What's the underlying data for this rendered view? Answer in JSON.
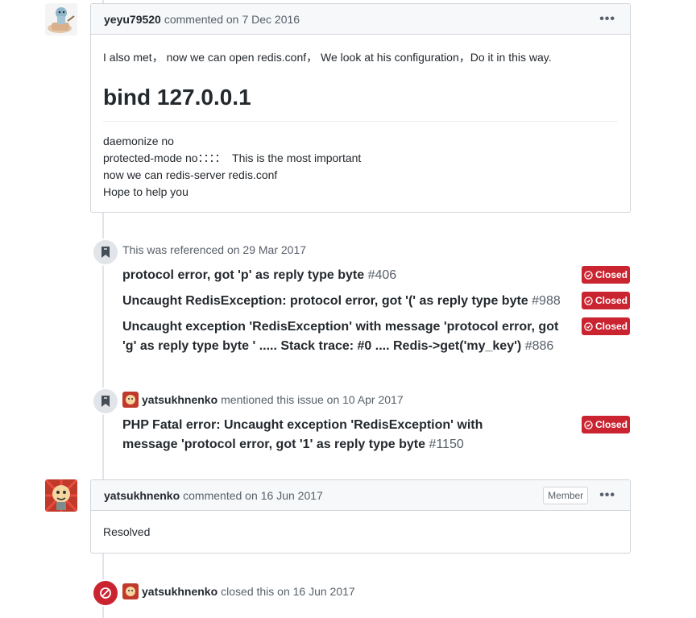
{
  "comment1": {
    "author": "yeyu79520",
    "action": "commented on",
    "date": "7 Dec 2016",
    "menu": "•••",
    "intro": "I also met， now we can open redis.conf， We look at his configuration，Do it in this way.",
    "heading": "bind 127.0.0.1",
    "lines": [
      "daemonize no",
      "protected-mode no：：：：  This is the most important",
      "now we can redis-server redis.conf",
      "Hope to help you"
    ]
  },
  "reference_event": {
    "text": "This was referenced on 29 Mar 2017",
    "items": [
      {
        "title": "protocol error, got 'p' as reply type byte",
        "number": "#406",
        "status": "Closed"
      },
      {
        "title": "Uncaught RedisException: protocol error, got '(' as reply type byte",
        "number": "#988",
        "status": "Closed"
      },
      {
        "title": "Uncaught exception 'RedisException' with message 'protocol error, got 'g' as reply type byte ' ..... Stack trace: #0 .... Redis->get('my_key')",
        "number": "#886",
        "status": "Closed"
      }
    ]
  },
  "mention_event": {
    "author": "yatsukhnenko",
    "text": "mentioned this issue on 10 Apr 2017",
    "item": {
      "title": "PHP Fatal error: Uncaught exception 'RedisException' with message 'protocol error, got '1' as reply type byte",
      "number": "#1150",
      "status": "Closed"
    }
  },
  "comment2": {
    "author": "yatsukhnenko",
    "action": "commented on",
    "date": "16 Jun 2017",
    "badge": "Member",
    "menu": "•••",
    "body": "Resolved"
  },
  "closed_event": {
    "author": "yatsukhnenko",
    "text": "closed this on 16 Jun 2017"
  },
  "colors": {
    "closed_red": "#cb2431",
    "border": "#d1d5da",
    "header_bg": "#f6f8fa",
    "muted": "#586069"
  },
  "icons": {
    "bookmark": "bookmark-icon",
    "closed_issue": "issue-closed-icon",
    "circle_slash": "circle-slash-icon",
    "menu": "kebab-icon"
  }
}
